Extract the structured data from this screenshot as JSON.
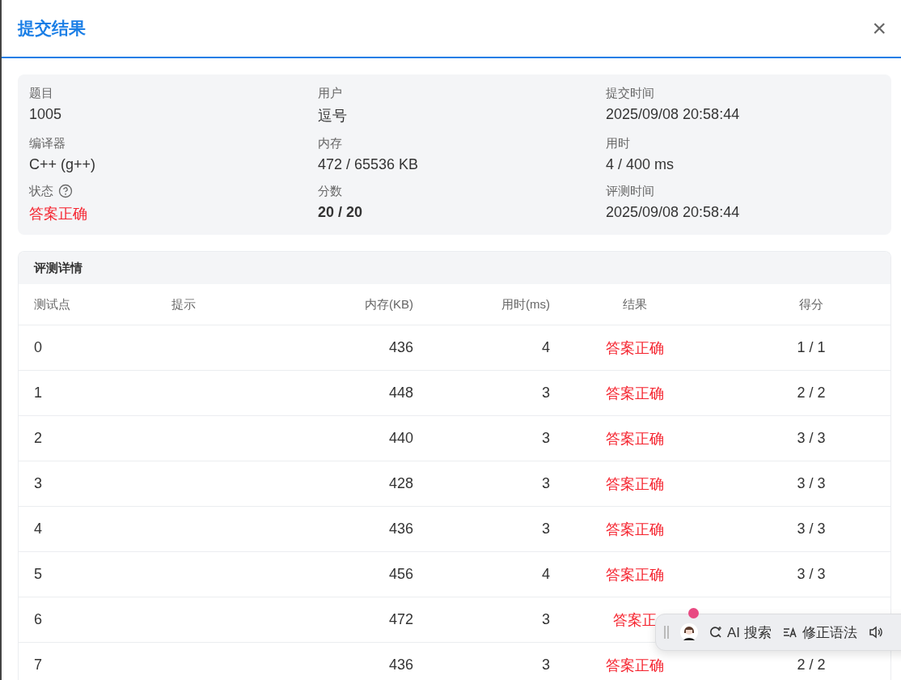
{
  "dialog": {
    "title": "提交结果",
    "close": "×"
  },
  "summary": [
    {
      "label": "题目",
      "value": "1005",
      "kind": "plain"
    },
    {
      "label": "用户",
      "value": "逗号",
      "kind": "plain"
    },
    {
      "label": "提交时间",
      "value": "2025/09/08 20:58:44",
      "kind": "plain"
    },
    {
      "label": "编译器",
      "value": "C++ (g++)",
      "kind": "plain"
    },
    {
      "label": "内存",
      "value": "472 / 65536 KB",
      "kind": "plain"
    },
    {
      "label": "用时",
      "value": "4 / 400 ms",
      "kind": "plain"
    },
    {
      "label": "状态",
      "value": "答案正确",
      "kind": "status",
      "help": true
    },
    {
      "label": "分数",
      "value": "20 / 20",
      "kind": "bold"
    },
    {
      "label": "评测时间",
      "value": "2025/09/08 20:58:44",
      "kind": "plain"
    }
  ],
  "details": {
    "title": "评测详情",
    "columns": [
      "测试点",
      "提示",
      "内存(KB)",
      "用时(ms)",
      "结果",
      "得分"
    ],
    "rows": [
      {
        "case": "0",
        "memory": "436",
        "time": "4",
        "result": "答案正确",
        "score": "1 / 1"
      },
      {
        "case": "1",
        "memory": "448",
        "time": "3",
        "result": "答案正确",
        "score": "2 / 2"
      },
      {
        "case": "2",
        "memory": "440",
        "time": "3",
        "result": "答案正确",
        "score": "3 / 3"
      },
      {
        "case": "3",
        "memory": "428",
        "time": "3",
        "result": "答案正确",
        "score": "3 / 3"
      },
      {
        "case": "4",
        "memory": "436",
        "time": "3",
        "result": "答案正确",
        "score": "3 / 3"
      },
      {
        "case": "5",
        "memory": "456",
        "time": "4",
        "result": "答案正确",
        "score": "3 / 3"
      },
      {
        "case": "6",
        "memory": "472",
        "time": "3",
        "result": "答案正"
      },
      {
        "case": "7",
        "memory": "436",
        "time": "3",
        "result": "答案正确",
        "score": "2 / 2"
      }
    ]
  },
  "floating_toolbar": {
    "items": [
      {
        "kind": "avatar",
        "badge": true
      },
      {
        "kind": "search",
        "label": "AI 搜索"
      },
      {
        "kind": "grammar",
        "label": "修正语法"
      },
      {
        "kind": "speaker"
      }
    ]
  }
}
